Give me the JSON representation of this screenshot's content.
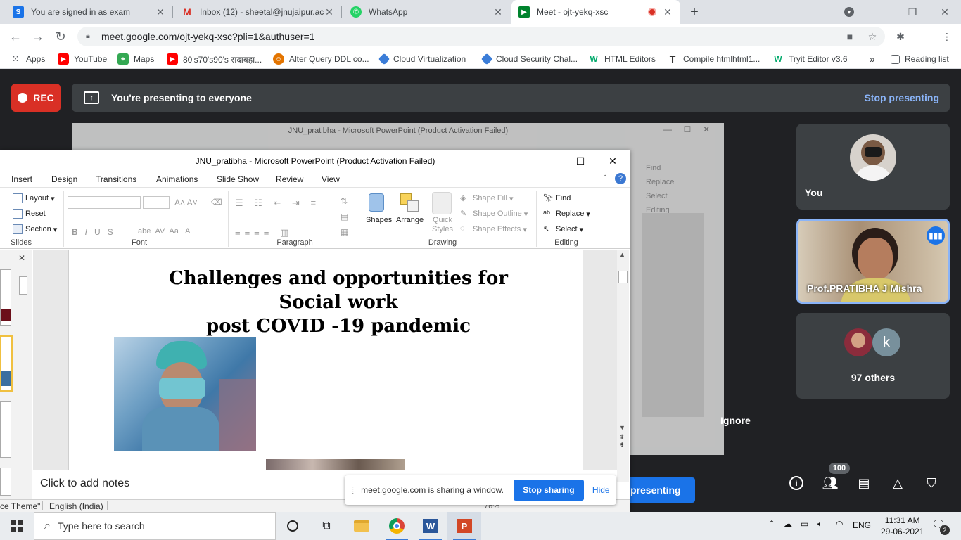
{
  "browser": {
    "tabs": [
      {
        "title": "You are signed in as exam",
        "icon": "exam-s-icon",
        "active": false
      },
      {
        "title": "Inbox (12) - sheetal@jnujaipur.ac",
        "icon": "gmail-icon",
        "active": false
      },
      {
        "title": "WhatsApp",
        "icon": "whatsapp-icon",
        "active": false
      },
      {
        "title": "Meet - ojt-yekq-xsc",
        "icon": "meet-icon",
        "active": true
      }
    ],
    "new_tab": "+",
    "address": "meet.google.com/ojt-yekq-xsc?pli=1&authuser=1",
    "bookmarks": [
      {
        "label": "Apps",
        "icon": "apps-grid-icon"
      },
      {
        "label": "YouTube",
        "icon": "youtube-icon"
      },
      {
        "label": "Maps",
        "icon": "maps-icon"
      },
      {
        "label": "80's70's90's सदाबहा...",
        "icon": "youtube-icon"
      },
      {
        "label": "Alter Query DDL co...",
        "icon": "tutorial-icon"
      },
      {
        "label": "Cloud Virtualization",
        "icon": "cloud-diamond-icon"
      },
      {
        "label": "Cloud Security Chal...",
        "icon": "cloud-diamond-icon"
      },
      {
        "label": "HTML Editors",
        "icon": "w3-icon"
      },
      {
        "label": "Compile htmlhtml1...",
        "icon": "text-t-icon"
      },
      {
        "label": "Tryit Editor v3.6",
        "icon": "w3-icon"
      }
    ],
    "more": "»",
    "reading_list": "Reading list"
  },
  "meet": {
    "rec_label": "REC",
    "presenting_text": "You're presenting to everyone",
    "stop_presenting": "Stop presenting",
    "tiles": [
      {
        "name": "You"
      },
      {
        "name": "Prof.PRATIBHA J Mishra"
      },
      {
        "name": "97 others",
        "avatar_letter": "k"
      }
    ],
    "people_count": "100",
    "present_button": "presenting",
    "ignore": "Ignore"
  },
  "ppt": {
    "title": "JNU_pratibha  -  Microsoft PowerPoint (Product Activation Failed)",
    "ghost_title": "JNU_pratibha  -  Microsoft PowerPoint (Product Activation Failed)",
    "ghost_tabs": [
      "Insert",
      "Design",
      "Transitions",
      "Animations",
      "Slide Show",
      "Review",
      "View"
    ],
    "ghost_editing": [
      "Find",
      "Replace",
      "Select",
      "Editing"
    ],
    "tabs": [
      "Insert",
      "Design",
      "Transitions",
      "Animations",
      "Slide Show",
      "Review",
      "View"
    ],
    "ribbon": {
      "slides": {
        "items": [
          "Layout",
          "Reset",
          "Section"
        ],
        "label": "Slides"
      },
      "font": {
        "label": "Font"
      },
      "paragraph": {
        "label": "Paragraph"
      },
      "drawing": {
        "shapes": "Shapes",
        "arrange": "Arrange",
        "quick_styles": "Quick Styles",
        "shape_fill": "Shape Fill",
        "shape_outline": "Shape Outline",
        "shape_effects": "Shape Effects",
        "label": "Drawing"
      },
      "editing": {
        "find": "Find",
        "replace": "Replace",
        "select": "Select",
        "label": "Editing"
      }
    },
    "slide_title_lines": [
      "Challenges and opportunities  for",
      "Social work",
      "post COVID -19 pandemic"
    ],
    "notes_placeholder": "Click to add notes",
    "status_theme": "ce Theme\"",
    "status_lang": "English (India)",
    "zoom": "76%"
  },
  "share_notice": {
    "text": "meet.google.com is sharing a window.",
    "stop": "Stop sharing",
    "hide": "Hide"
  },
  "taskbar": {
    "search_placeholder": "Type here to search",
    "lang": "ENG",
    "time": "11:31 AM",
    "date": "29-06-2021",
    "notif_count": "2"
  },
  "colors": {
    "meet_bg": "#202124",
    "rec_red": "#d93025",
    "meet_blue": "#1a73e8",
    "link_blue": "#8ab4f8"
  }
}
